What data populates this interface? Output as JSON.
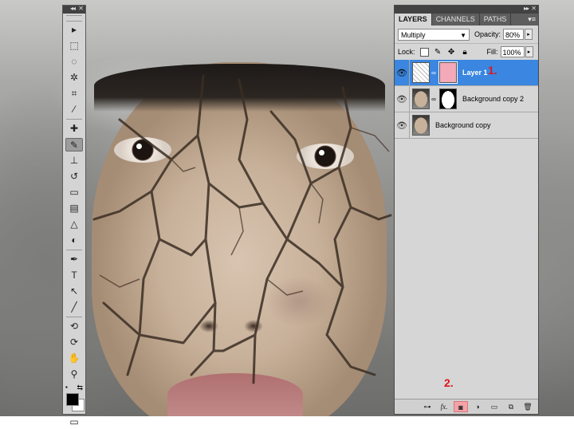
{
  "tools_panel": {
    "tools": [
      {
        "name": "move-tool",
        "glyph": "▸"
      },
      {
        "name": "marquee-tool",
        "glyph": "⬚"
      },
      {
        "name": "lasso-tool",
        "glyph": "◌"
      },
      {
        "name": "quick-selection-tool",
        "glyph": "✲"
      },
      {
        "name": "crop-tool",
        "glyph": "⌗"
      },
      {
        "name": "eyedropper-tool",
        "glyph": "⁄"
      },
      {
        "name": "healing-brush-tool",
        "glyph": "✚"
      },
      {
        "name": "brush-tool",
        "glyph": "✎"
      },
      {
        "name": "clone-stamp-tool",
        "glyph": "⊥"
      },
      {
        "name": "history-brush-tool",
        "glyph": "↺"
      },
      {
        "name": "eraser-tool",
        "glyph": "▭"
      },
      {
        "name": "gradient-tool",
        "glyph": "▤"
      },
      {
        "name": "blur-tool",
        "glyph": "△"
      },
      {
        "name": "dodge-tool",
        "glyph": "◐"
      },
      {
        "name": "pen-tool",
        "glyph": "✒"
      },
      {
        "name": "type-tool",
        "glyph": "T"
      },
      {
        "name": "path-selection-tool",
        "glyph": "↖"
      },
      {
        "name": "line-tool",
        "glyph": "╱"
      },
      {
        "name": "3d-rotate-tool",
        "glyph": "⟲"
      },
      {
        "name": "3d-orbit-tool",
        "glyph": "⟳"
      },
      {
        "name": "hand-tool",
        "glyph": "✋"
      },
      {
        "name": "zoom-tool",
        "glyph": "⚲"
      }
    ],
    "active_tool": "brush-tool",
    "foreground_color": "#000000",
    "background_color": "#ffffff"
  },
  "layers_panel": {
    "tabs": [
      "LAYERS",
      "CHANNELS",
      "PATHS"
    ],
    "active_tab": "LAYERS",
    "blend_mode": "Multiply",
    "opacity_label": "Opacity:",
    "opacity_value": "80%",
    "lock_label": "Lock:",
    "fill_label": "Fill:",
    "fill_value": "100%",
    "layers": [
      {
        "name": "Layer 1",
        "selected": true,
        "marker": "1."
      },
      {
        "name": "Background copy 2",
        "selected": false
      },
      {
        "name": "Background copy",
        "selected": false
      }
    ],
    "footer_marker": "2.",
    "footer_buttons": [
      "link-layers",
      "fx",
      "add-layer-mask",
      "adjustment-layer",
      "new-group",
      "new-layer",
      "delete-layer"
    ],
    "highlight_color": "#f2a3a8",
    "selection_color": "#3a86e0",
    "marker_color": "#e1141e"
  }
}
